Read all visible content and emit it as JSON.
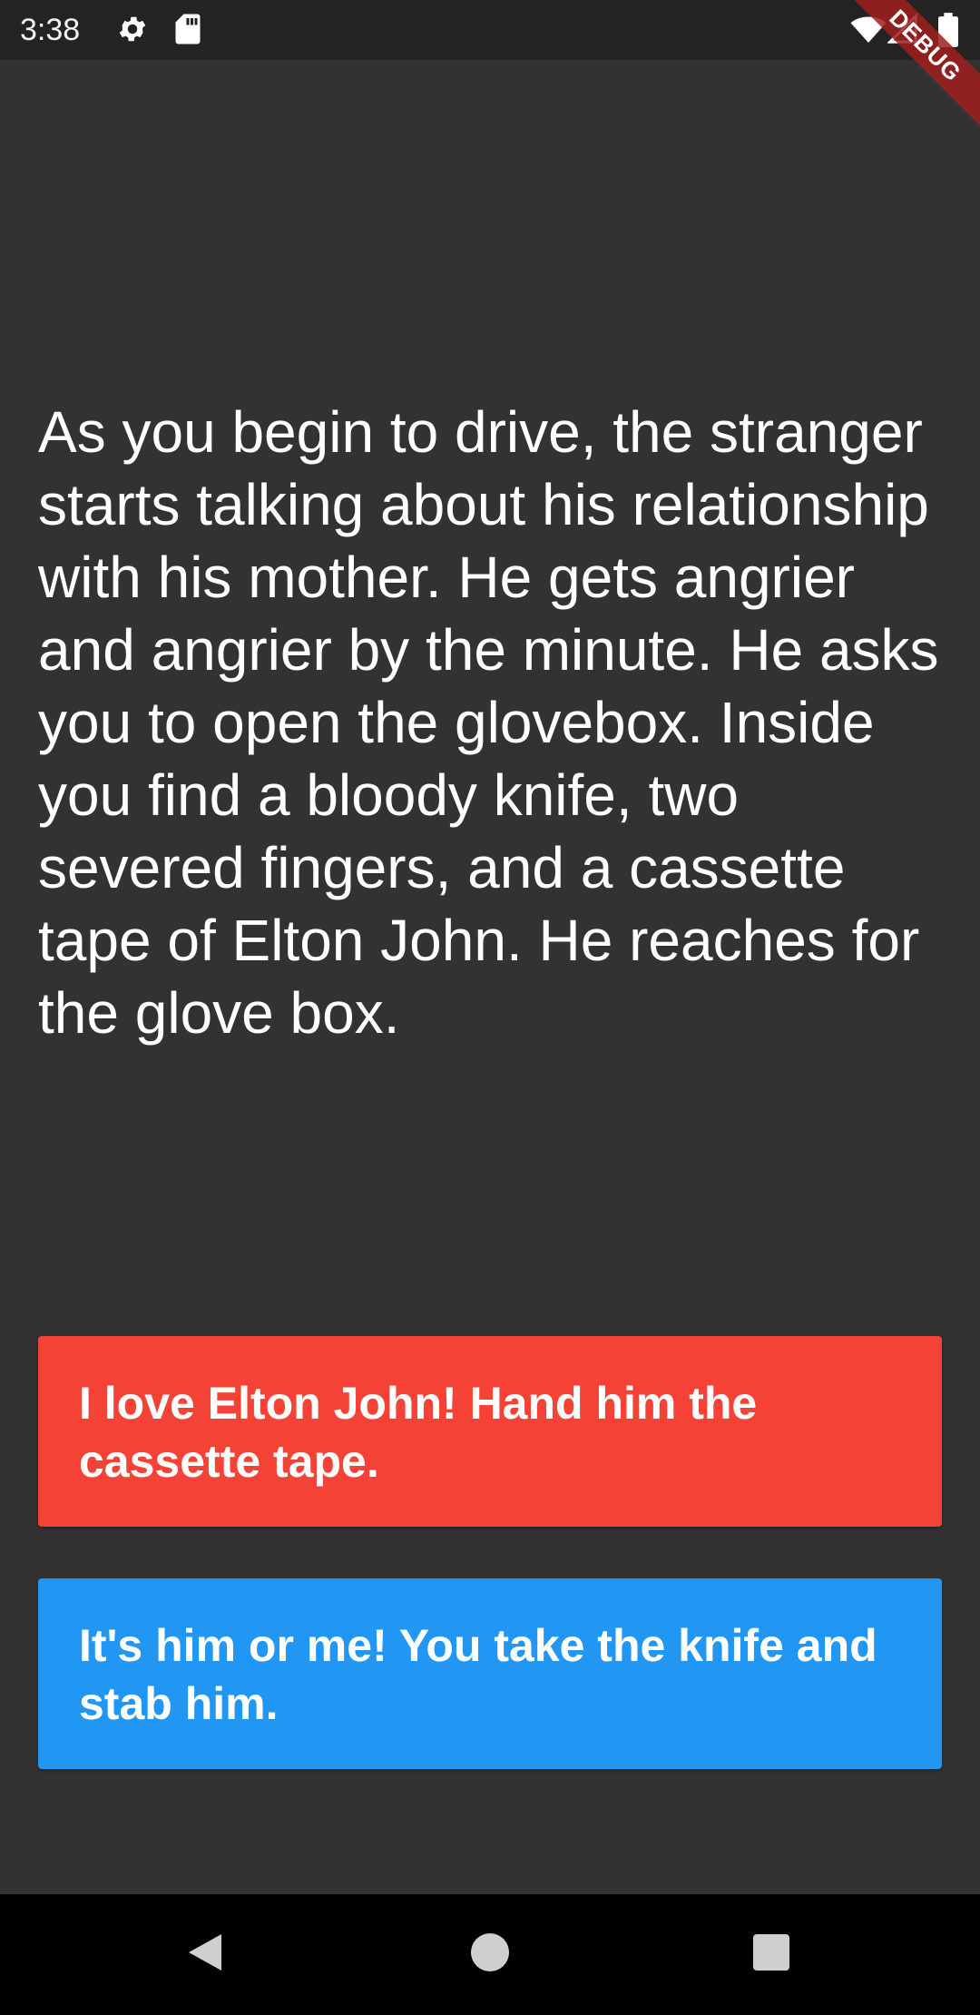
{
  "status_bar": {
    "time": "3:38",
    "icons": [
      "gear-icon",
      "sd-card-icon",
      "wifi-icon",
      "cellular-signal-icon",
      "battery-icon"
    ]
  },
  "debug_banner": {
    "label": "DEBUG"
  },
  "story": {
    "text": "As you begin to drive, the stranger starts talking about his relationship with his mother. He gets angrier and angrier by the minute. He asks you to open the glovebox. Inside you find a bloody knife, two severed fingers, and a cassette tape of Elton John. He reaches for the glove box."
  },
  "choices": [
    {
      "label": "I love Elton John! Hand him the cassette tape.",
      "color": "#f44336"
    },
    {
      "label": "It's him or me! You take the knife and stab him.",
      "color": "#2196f3"
    }
  ],
  "nav_bar": {
    "icons": [
      "back-icon",
      "home-icon",
      "recents-icon"
    ]
  },
  "colors": {
    "background": "#323232",
    "status_bar": "#232323",
    "nav_bar": "#000000"
  }
}
